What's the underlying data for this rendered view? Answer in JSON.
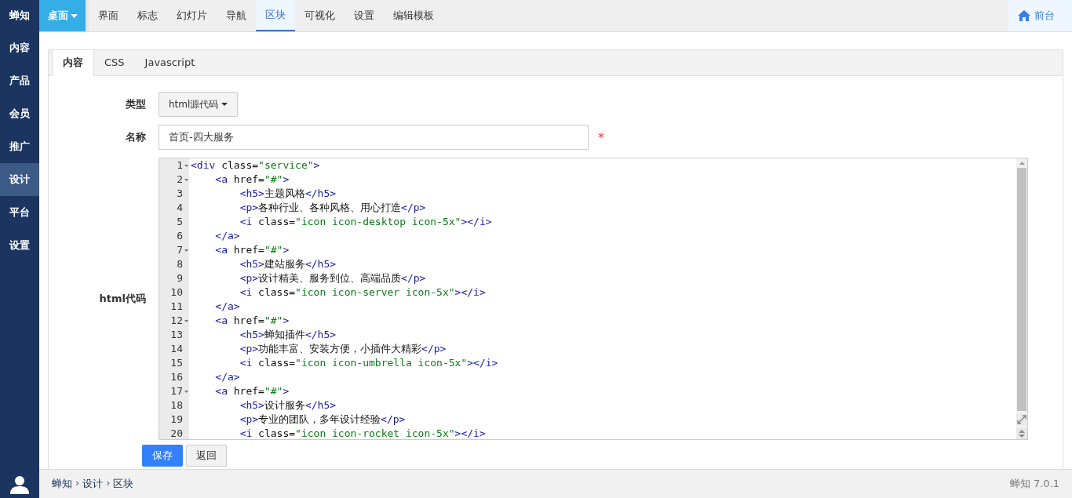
{
  "brand": "蝉知",
  "sidebar": {
    "items": [
      {
        "label": "内容",
        "selected": false
      },
      {
        "label": "产品",
        "selected": false
      },
      {
        "label": "会员",
        "selected": false
      },
      {
        "label": "推广",
        "selected": false
      },
      {
        "label": "设计",
        "selected": true
      },
      {
        "label": "平台",
        "selected": false
      },
      {
        "label": "设置",
        "selected": false
      }
    ]
  },
  "topbar": {
    "menu": {
      "label": "桌面"
    },
    "tabs": [
      {
        "label": "界面",
        "selected": false
      },
      {
        "label": "标志",
        "selected": false
      },
      {
        "label": "幻灯片",
        "selected": false
      },
      {
        "label": "导航",
        "selected": false
      },
      {
        "label": "区块",
        "selected": true
      },
      {
        "label": "可视化",
        "selected": false
      },
      {
        "label": "设置",
        "selected": false
      },
      {
        "label": "编辑模板",
        "selected": false
      }
    ],
    "frontend_link": "前台"
  },
  "panel": {
    "tabs": [
      {
        "label": "内容",
        "selected": true
      },
      {
        "label": "CSS",
        "selected": false
      },
      {
        "label": "Javascript",
        "selected": false
      }
    ],
    "form": {
      "type": {
        "label": "类型",
        "value": "html源代码"
      },
      "name": {
        "label": "名称",
        "value": "首页-四大服务",
        "required": true,
        "required_mark": "*"
      },
      "code": {
        "label": "html代码",
        "lines": [
          {
            "number": "1",
            "foldable": true,
            "text": "<div class=\"service\">"
          },
          {
            "number": "2",
            "foldable": true,
            "text": "    <a href=\"#\">"
          },
          {
            "number": "3",
            "foldable": false,
            "text": "        <h5>主题风格</h5>"
          },
          {
            "number": "4",
            "foldable": false,
            "text": "        <p>各种行业、各种风格、用心打造</p>"
          },
          {
            "number": "5",
            "foldable": false,
            "text": "        <i class=\"icon icon-desktop icon-5x\"></i>"
          },
          {
            "number": "6",
            "foldable": false,
            "text": "    </a>"
          },
          {
            "number": "7",
            "foldable": true,
            "text": "    <a href=\"#\">"
          },
          {
            "number": "8",
            "foldable": false,
            "text": "        <h5>建站服务</h5>"
          },
          {
            "number": "9",
            "foldable": false,
            "text": "        <p>设计精美、服务到位、高端品质</p>"
          },
          {
            "number": "10",
            "foldable": false,
            "text": "        <i class=\"icon icon-server icon-5x\"></i>"
          },
          {
            "number": "11",
            "foldable": false,
            "text": "    </a>"
          },
          {
            "number": "12",
            "foldable": true,
            "text": "    <a href=\"#\">"
          },
          {
            "number": "13",
            "foldable": false,
            "text": "        <h5>蝉知插件</h5>"
          },
          {
            "number": "14",
            "foldable": false,
            "text": "        <p>功能丰富、安装方便，小插件大精彩</p>"
          },
          {
            "number": "15",
            "foldable": false,
            "text": "        <i class=\"icon icon-umbrella icon-5x\"></i>"
          },
          {
            "number": "16",
            "foldable": false,
            "text": "    </a>"
          },
          {
            "number": "17",
            "foldable": true,
            "text": "    <a href=\"#\">"
          },
          {
            "number": "18",
            "foldable": false,
            "text": "        <h5>设计服务</h5>"
          },
          {
            "number": "19",
            "foldable": false,
            "text": "        <p>专业的团队，多年设计经验</p>"
          },
          {
            "number": "20",
            "foldable": false,
            "text": "        <i class=\"icon icon-rocket icon-5x\"></i>"
          }
        ]
      },
      "buttons": [
        {
          "label": "保存",
          "kind": "primary"
        },
        {
          "label": "返回",
          "kind": "default"
        }
      ]
    }
  },
  "footer": {
    "breadcrumb": [
      "蝉知",
      "设计",
      "区块"
    ],
    "separator": "›",
    "version": "蝉知 7.0.1"
  }
}
